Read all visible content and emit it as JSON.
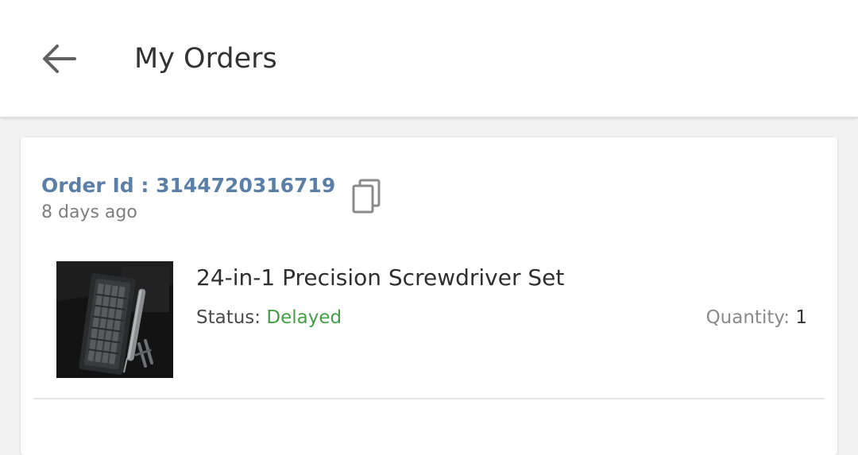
{
  "header": {
    "title": "My Orders",
    "back_icon": "arrow-left-icon"
  },
  "order": {
    "id_label": "Order Id : ",
    "id_value": "3144720316719",
    "age": "8 days ago",
    "copy_icon": "copy-icon",
    "item": {
      "name": "24-in-1 Precision Screwdriver Set",
      "status_label": "Status: ",
      "status_value": "Delayed",
      "quantity_label": "Quantity: ",
      "quantity_value": "1"
    }
  },
  "colors": {
    "order_id": "#5b7fa6",
    "status_delayed": "#43a047",
    "background": "#f1f1f1"
  }
}
